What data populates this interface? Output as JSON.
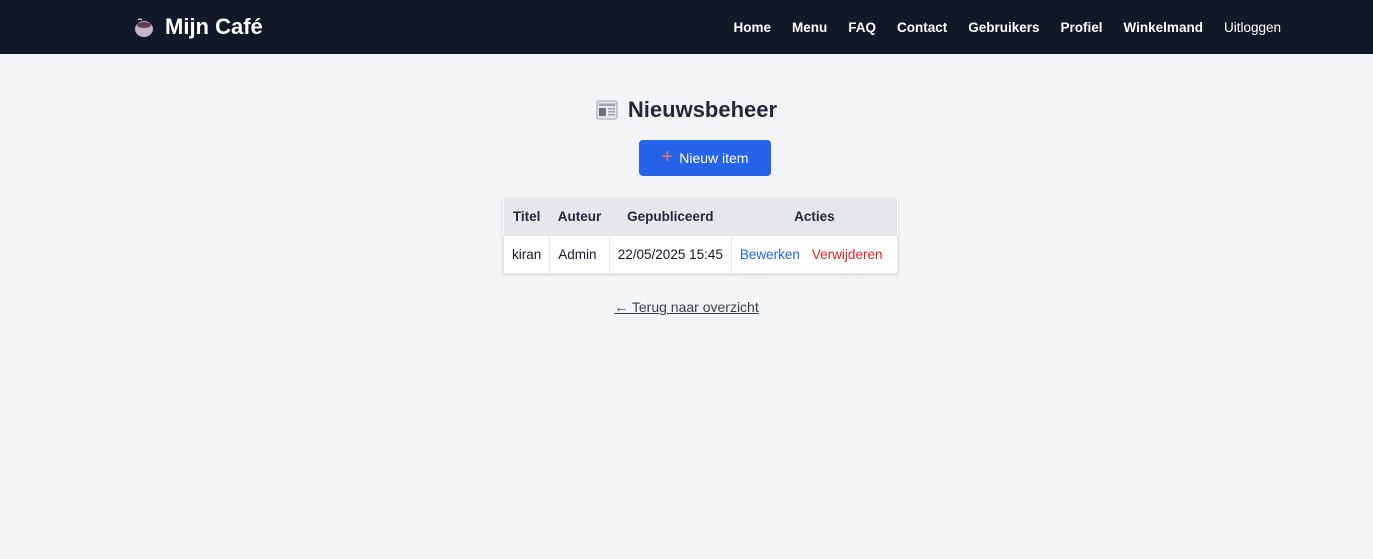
{
  "brand": {
    "icon": "coffee-cup-icon",
    "name": "Mijn Café"
  },
  "nav": {
    "items": [
      {
        "label": "Home"
      },
      {
        "label": "Menu"
      },
      {
        "label": "FAQ"
      },
      {
        "label": "Contact"
      },
      {
        "label": "Gebruikers"
      },
      {
        "label": "Profiel"
      },
      {
        "label": "Winkelmand"
      },
      {
        "label": "Uitloggen"
      }
    ]
  },
  "page": {
    "title_icon": "newspaper-icon",
    "title": "Nieuwsbeheer",
    "new_button": {
      "icon": "plus-icon",
      "label": "Nieuw item"
    },
    "back_link": "← Terug naar overzicht"
  },
  "table": {
    "headers": [
      "Titel",
      "Auteur",
      "Gepubliceerd",
      "Acties"
    ],
    "rows": [
      {
        "titel": "kiran",
        "auteur": "Admin",
        "gepubliceerd": "22/05/2025 15:45",
        "edit_label": "Bewerken",
        "delete_label": "Verwijderen"
      }
    ]
  },
  "colors": {
    "navbar": "#111827",
    "primary": "#2563eb",
    "danger": "#dc2626",
    "background": "#f3f4f6"
  }
}
